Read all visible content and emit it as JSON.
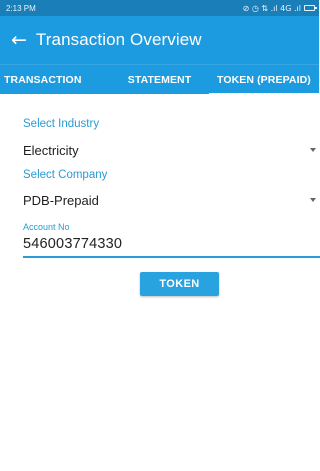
{
  "status_bar": {
    "time": "2:13 PM",
    "indicators": "⊘ ◷ ⇅ .ıl 4G .ıl",
    "icons": [
      "alarm-icon",
      "data-icon",
      "signal-icon",
      "battery-icon"
    ]
  },
  "app_bar": {
    "title": "Transaction Overview",
    "back_icon": "arrow-left-icon"
  },
  "tabs": [
    {
      "label": "TRANSACTION",
      "active": false
    },
    {
      "label": "STATEMENT",
      "active": false
    },
    {
      "label": "TOKEN (PREPAID)",
      "active": true
    }
  ],
  "form": {
    "industry_label": "Select Industry",
    "industry_value": "Electricity",
    "company_label": "Select Company",
    "company_value": "PDB-Prepaid",
    "account_label": "Account No",
    "account_value": "546003774330",
    "submit_label": "TOKEN"
  },
  "colors": {
    "primary": "#1d9be0",
    "status_bar": "#1a7fb8",
    "accent": "#2a9bd4"
  }
}
